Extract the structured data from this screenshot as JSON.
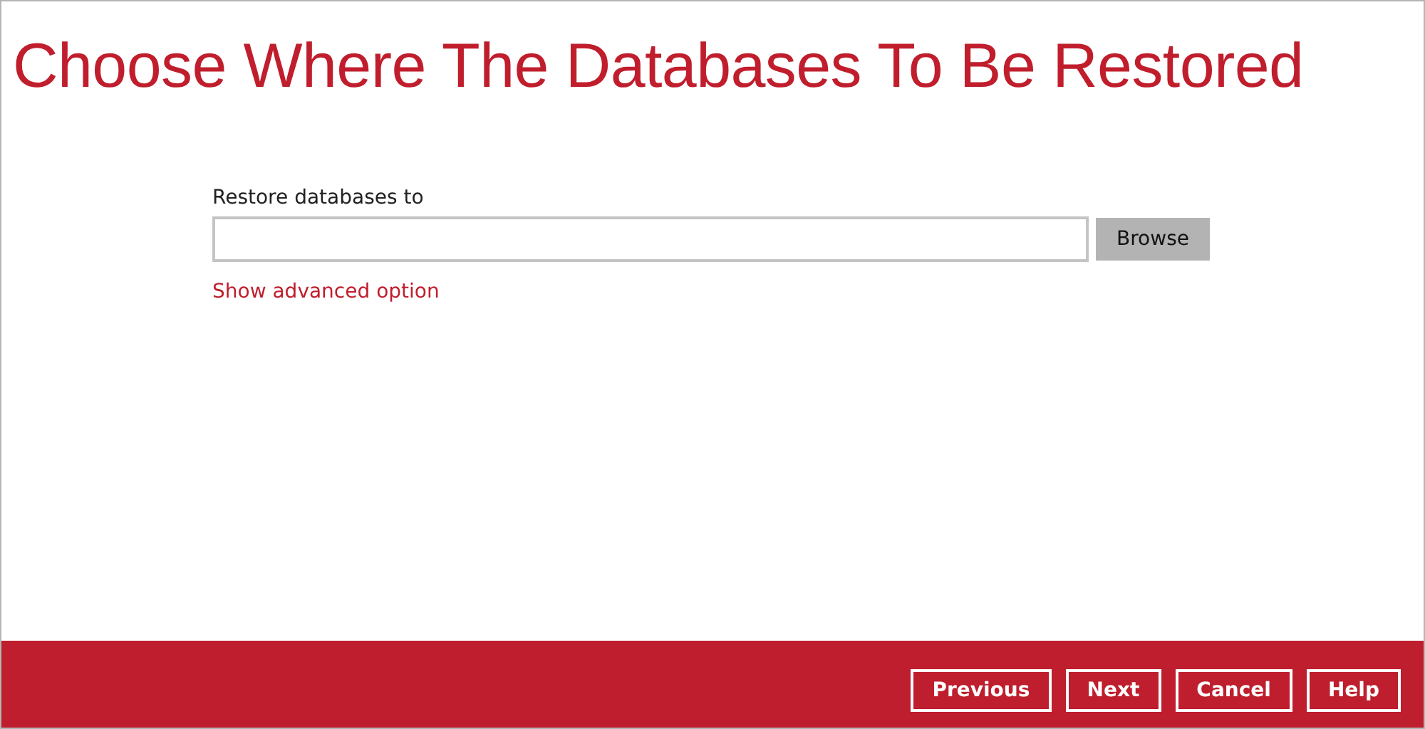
{
  "title": "Choose Where The Databases To Be Restored",
  "destination": {
    "label": "Restore databases to",
    "browse_button": "Browse"
  },
  "advanced_link": "Show advanced option",
  "footer_buttons": [
    "Previous",
    "Next",
    "Cancel",
    "Help"
  ]
}
